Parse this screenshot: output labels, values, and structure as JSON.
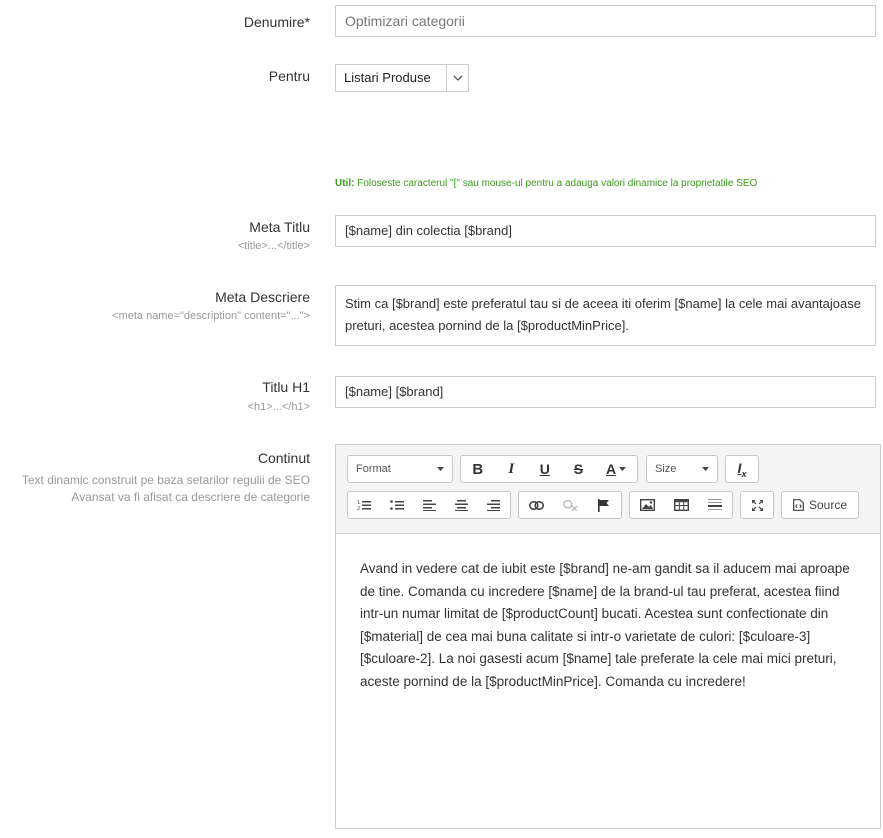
{
  "form": {
    "name": {
      "label": "Denumire*",
      "value": "Optimizari categorii"
    },
    "for": {
      "label": "Pentru",
      "selected": "Listari Produse"
    },
    "tip": {
      "bold": "Util:",
      "text": " Foloseste caracterul \"[\" sau mouse-ul pentru a adauga valori dinamice la proprietatile SEO"
    },
    "meta_title": {
      "label": "Meta Titlu",
      "hint": "<title>...</title>",
      "value": "[$name] din colectia [$brand]"
    },
    "meta_description": {
      "label": "Meta Descriere",
      "hint": "<meta name=\"description\" content=\"...\">",
      "value": "Stim ca [$brand] este preferatul tau  si de aceea iti oferim [$name] la cele mai avantajoase preturi,  acestea pornind de la [$productMinPrice]."
    },
    "h1": {
      "label": "Titlu H1",
      "hint": "<h1>...</h1>",
      "value": "[$name] [$brand]"
    },
    "content": {
      "label": "Continut",
      "hint": "Text dinamic construit pe baza setarilor regulii de SEO Avansat va fi  afisat ca descriere de categorie",
      "text": "Avand in vedere cat de iubit este [$brand] ne-am gandit sa il aducem mai aproape de tine. Comanda cu incredere [$name] de la brand-ul tau preferat, acestea fiind intr-un numar limitat de [$productCount] bucati. Acestea sunt confectionate din [$material] de cea mai buna calitate si intr-o varietate de culori: [$culoare-3] [$culoare-2]. La noi gasesti acum [$name] tale preferate la cele mai mici preturi, aceste pornind de la [$productMinPrice]. Comanda cu incredere!"
    }
  },
  "editor": {
    "format_label": "Format",
    "size_label": "Size",
    "source_label": "Source",
    "bold": "B",
    "italic": "I",
    "underline": "U",
    "strike": "S",
    "text_color": "A"
  }
}
